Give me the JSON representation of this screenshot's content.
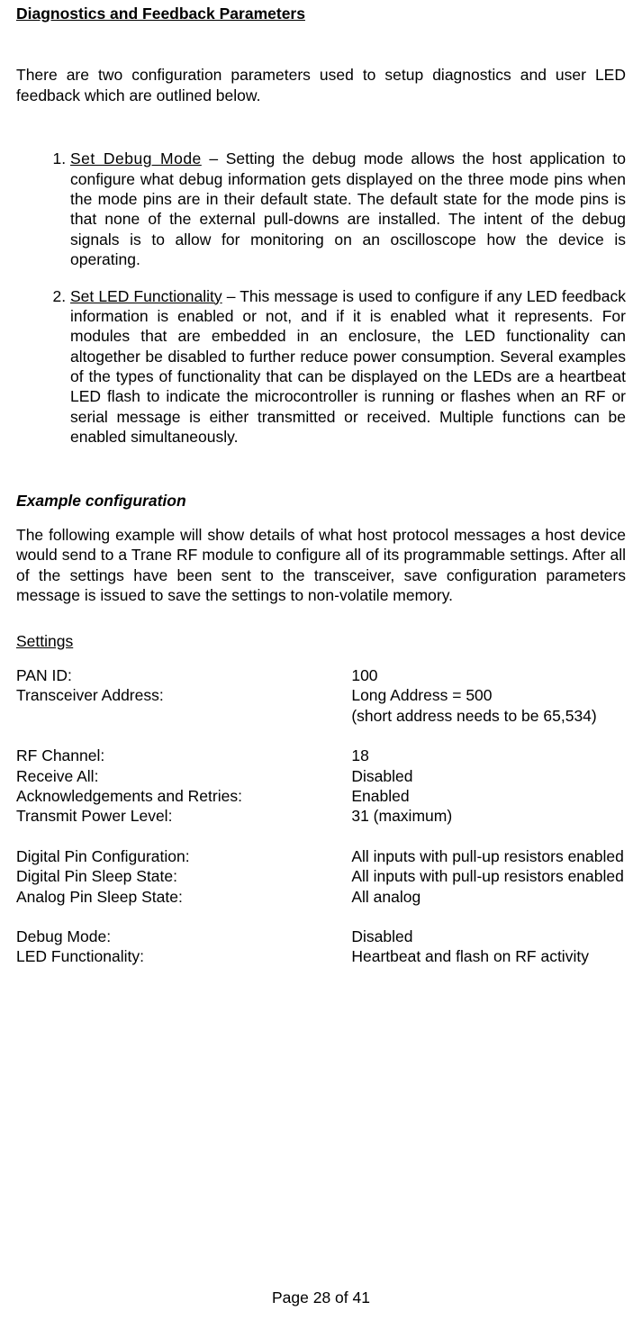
{
  "sectionTitle": "Diagnostics and Feedback Parameters",
  "intro": "There are two configuration parameters used to setup diagnostics and user LED feedback which are outlined below.",
  "params": [
    {
      "title": "Set Debug Mode",
      "body": " – Setting the debug mode allows the host application to configure what debug information gets displayed on the three mode pins when the mode pins are in their default state.  The default state for the mode pins is that none of the external pull-downs are installed.  The intent of the debug signals is to allow for monitoring on an oscilloscope how the device is operating."
    },
    {
      "title": "Set LED Functionality",
      "body": " – This message is used to configure if any LED feedback information is enabled or not, and if it is enabled what it represents.  For modules that are embedded in an enclosure, the LED functionality can altogether be disabled to further reduce power consumption.  Several examples of the types of functionality that can be displayed on the LEDs are a heartbeat LED flash to indicate the microcontroller is running or flashes when an RF or serial message is either transmitted or received.  Multiple functions can be enabled simultaneously."
    }
  ],
  "exampleHeading": "Example configuration",
  "exampleIntro": "The following example will show details of what host protocol messages a host device would send to a Trane RF module to configure all of its programmable settings.  After all of the settings have been sent to the transceiver, save configuration parameters message is issued to save the settings to non-volatile memory.",
  "settingsTitle": "Settings",
  "settings": {
    "panIdLabel": "PAN ID:",
    "panIdValue": "100",
    "transAddrLabel": "Transceiver Address:",
    "transAddrValue": "Long Address = 500",
    "transAddrNote": "(short address needs to be 65,534)",
    "rfChannelLabel": "RF Channel:",
    "rfChannelValue": "18",
    "receiveAllLabel": "Receive All:",
    "receiveAllValue": "Disabled",
    "ackLabel": "Acknowledgements and Retries:",
    "ackValue": "Enabled",
    "txPowerLabel": "Transmit Power Level:",
    "txPowerValue": "31 (maximum)",
    "digPinConfLabel": "Digital Pin Configuration:",
    "digPinConfValue": "All inputs with pull-up resistors enabled",
    "digPinSleepLabel": "Digital Pin Sleep State:",
    "digPinSleepValue": "All inputs with pull-up resistors enabled",
    "anaPinSleepLabel": "Analog Pin Sleep State:",
    "anaPinSleepValue": "All analog",
    "debugModeLabel": "Debug Mode:",
    "debugModeValue": "Disabled",
    "ledFuncLabel": "LED Functionality:",
    "ledFuncValue": "Heartbeat and flash on RF activity"
  },
  "footer": "Page 28 of 41"
}
